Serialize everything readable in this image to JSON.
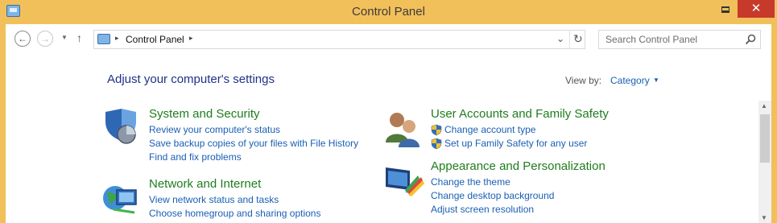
{
  "window": {
    "title": "Control Panel",
    "minimize_glyph": "",
    "close_glyph": "✕"
  },
  "nav": {
    "back_glyph": "←",
    "forward_glyph": "→",
    "recent_glyph": "▼",
    "up_glyph": "↑",
    "breadcrumb": "Control Panel",
    "crumb_sep": "▸",
    "address_dropdown_glyph": "⌄",
    "refresh_glyph": "↻",
    "search_placeholder": "Search Control Panel"
  },
  "content": {
    "page_title": "Adjust your computer's settings",
    "view_by_label": "View by:",
    "view_by_value": "Category",
    "view_by_caret": "▼"
  },
  "categories": [
    {
      "title": "System and Security",
      "icon": "system-security-shield-icon",
      "links": [
        "Review your computer's status",
        "Save backup copies of your files with File History",
        "Find and fix problems"
      ]
    },
    {
      "title": "Network and Internet",
      "icon": "network-globe-icon",
      "links": [
        "View network status and tasks",
        "Choose homegroup and sharing options"
      ]
    },
    {
      "title": "User Accounts and Family Safety",
      "icon": "users-icon",
      "links": [
        "Change account type",
        "Set up Family Safety for any user"
      ]
    },
    {
      "title": "Appearance and Personalization",
      "icon": "appearance-monitor-icon",
      "links": [
        "Change the theme",
        "Change desktop background",
        "Adjust screen resolution"
      ]
    }
  ],
  "scrollbar": {
    "up_glyph": "▲",
    "down_glyph": "▼"
  },
  "colors": {
    "frame": "#f2c05a",
    "close_button": "#c7392b",
    "title_blue": "#1e3287",
    "category_green": "#1e7d1e",
    "link_blue": "#1a5fb4"
  }
}
